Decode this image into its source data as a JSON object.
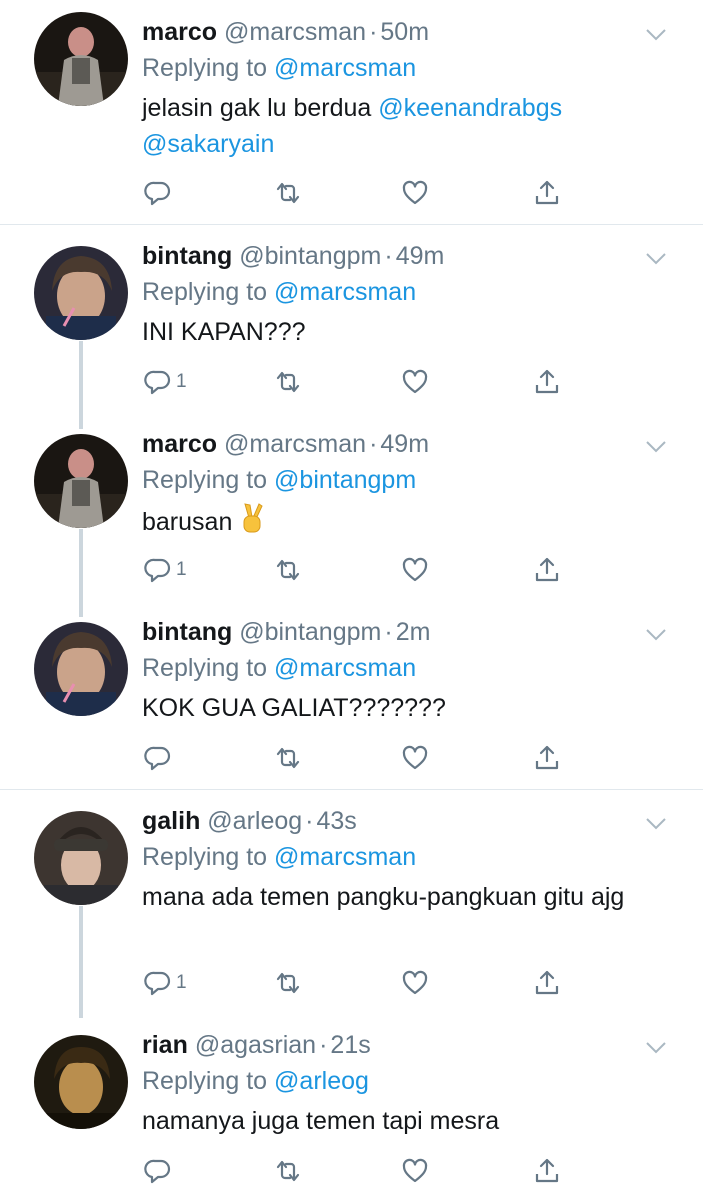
{
  "tweets": [
    {
      "name": "marco",
      "handle": "@marcsman",
      "time": "50m",
      "replying_label": "Replying to",
      "replying_to": "@marcsman",
      "text": "jelasin gak lu berdua ",
      "text_mentions": [
        "@keenandrabgs",
        "@sakaryain"
      ],
      "reply_count": ""
    },
    {
      "name": "bintang",
      "handle": "@bintangpm",
      "time": "49m",
      "replying_label": "Replying to",
      "replying_to": "@marcsman",
      "text": "INI KAPAN???",
      "reply_count": "1"
    },
    {
      "name": "marco",
      "handle": "@marcsman",
      "time": "49m",
      "replying_label": "Replying to",
      "replying_to": "@bintangpm",
      "text": "barusan ",
      "emoji": "victory-hand-emoji",
      "reply_count": "1"
    },
    {
      "name": "bintang",
      "handle": "@bintangpm",
      "time": "2m",
      "replying_label": "Replying to",
      "replying_to": "@marcsman",
      "text": "KOK GUA GALIAT???????",
      "reply_count": ""
    },
    {
      "name": "galih",
      "handle": "@arleog",
      "time": "43s",
      "replying_label": "Replying to",
      "replying_to": "@marcsman",
      "text": "mana ada temen pangku-pangkuan gitu ajg",
      "reply_count": "1"
    },
    {
      "name": "rian",
      "handle": "@agasrian",
      "time": "21s",
      "replying_label": "Replying to",
      "replying_to": "@arleog",
      "text": "namanya juga temen tapi mesra",
      "reply_count": ""
    }
  ],
  "colors": {
    "link": "#1b95e0",
    "secondary": "#657786",
    "divider": "#e1e8ed",
    "thread_line": "#ccd6dd"
  },
  "icons": [
    "reply-icon",
    "retweet-icon",
    "like-icon",
    "share-icon",
    "chevron-down-icon"
  ]
}
